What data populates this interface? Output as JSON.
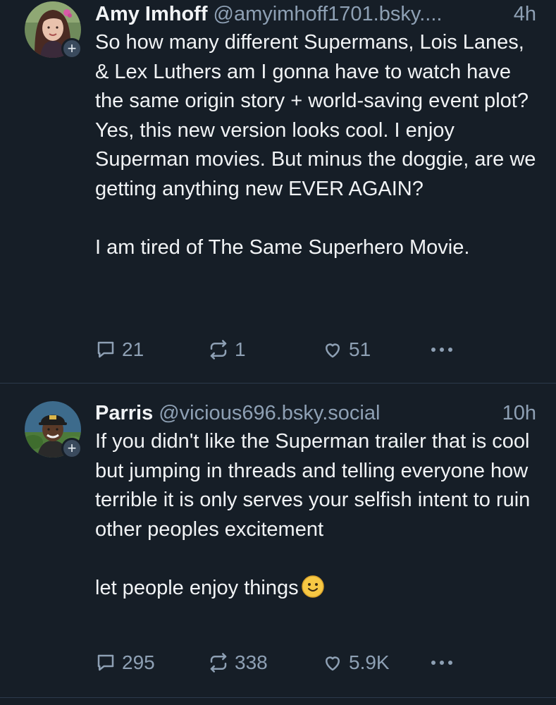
{
  "posts": [
    {
      "author_name": "Amy Imhoff",
      "handle": "@amyimhoff1701.bsky....",
      "time": "4h",
      "text": "So how many different Supermans, Lois Lanes, & Lex Luthers am I gonna have to watch have the same origin story + world-saving event plot? Yes, this new version looks cool. I enjoy Superman movies. But minus the doggie, are we getting anything new EVER AGAIN?\n\nI am tired of The Same Superhero Movie.",
      "replies": "21",
      "reposts": "1",
      "likes": "51"
    },
    {
      "author_name": "Parris",
      "handle": "@vicious696.bsky.social",
      "time": "10h",
      "text": "If you didn't like the Superman trailer that is cool but jumping in threads and telling everyone how terrible it is only serves your selfish intent to ruin other peoples excitement\n\nlet people enjoy things",
      "replies": "295",
      "reposts": "338",
      "likes": "5.9K"
    }
  ],
  "follow_badge": "+",
  "colors": {
    "background": "#161e27",
    "text": "#f1f3f5",
    "muted": "#8ea0b4",
    "divider": "#2c3a4b"
  },
  "icons": [
    "reply-icon",
    "repost-icon",
    "like-icon",
    "more-icon",
    "slightly-smiling-face-emoji"
  ]
}
